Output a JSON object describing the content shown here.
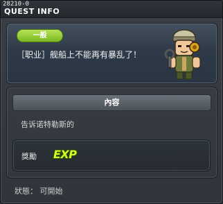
{
  "window": {
    "quest_id": "28210-0",
    "title": "QUEST INFO",
    "close_label": "×"
  },
  "quest": {
    "category_badge": "一般",
    "name": "［职业］舰船上不能再有暴乱了！",
    "npc_icon": "soldier-npc-icon"
  },
  "content": {
    "header": "內容",
    "description": "告诉诺特勒斯的"
  },
  "reward": {
    "label": "獎勵",
    "exp_label": "EXP"
  },
  "status": {
    "text": "狀態： 可開始"
  },
  "colors": {
    "badge_green": "#8cc63f",
    "exp_yellow": "#cfff2a",
    "title_text": "#ffffff"
  }
}
